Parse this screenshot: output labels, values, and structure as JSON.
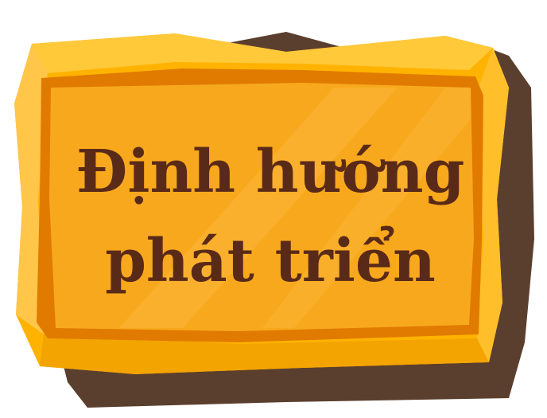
{
  "sign": {
    "line1": "Định hướng",
    "line2": "phát triển"
  },
  "colors": {
    "shadow": "#5b3f2e",
    "outer_frame": "#ffb300",
    "outer_highlight": "#ffc93a",
    "inner_border": "#e07b00",
    "inner_panel": "#f8a81c",
    "panel_stripe": "#fbb73a",
    "text": "#5a2a18"
  }
}
